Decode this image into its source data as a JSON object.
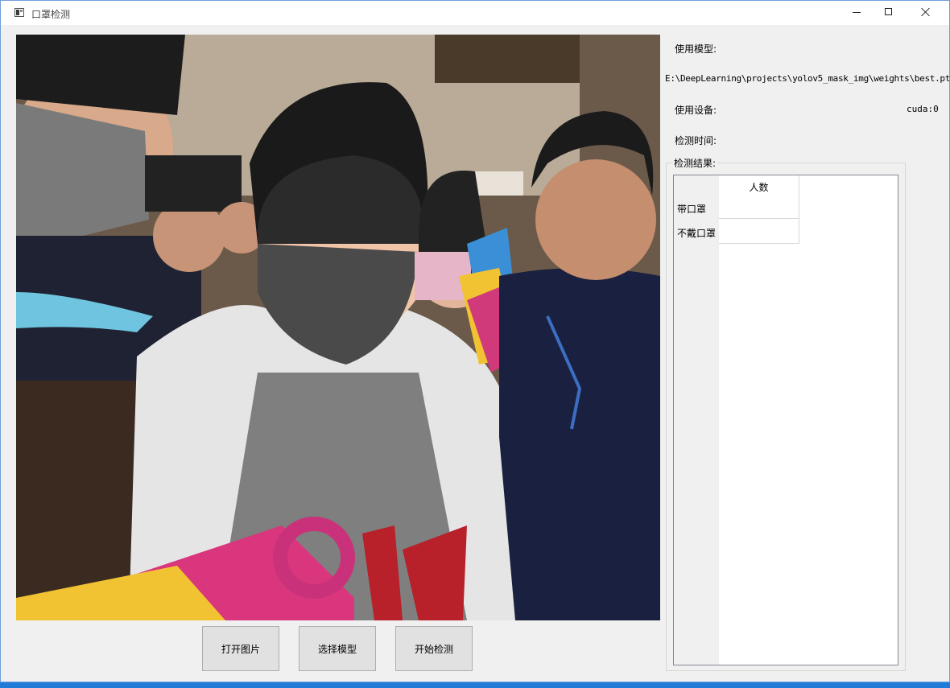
{
  "window": {
    "title": "口罩检测"
  },
  "buttons": {
    "open_image": "打开图片",
    "select_model": "选择模型",
    "start_detect": "开始检测"
  },
  "info": {
    "model_label": "使用模型:",
    "model_path": "E:\\DeepLearning\\projects\\yolov5_mask_img\\weights\\best.pt",
    "device_label": "使用设备:",
    "device_value": "cuda:0",
    "time_label": "检测时间:"
  },
  "results": {
    "group_title": "检测结果:",
    "column_header": "人数",
    "rows": [
      "带口罩",
      "不戴口罩"
    ]
  }
}
